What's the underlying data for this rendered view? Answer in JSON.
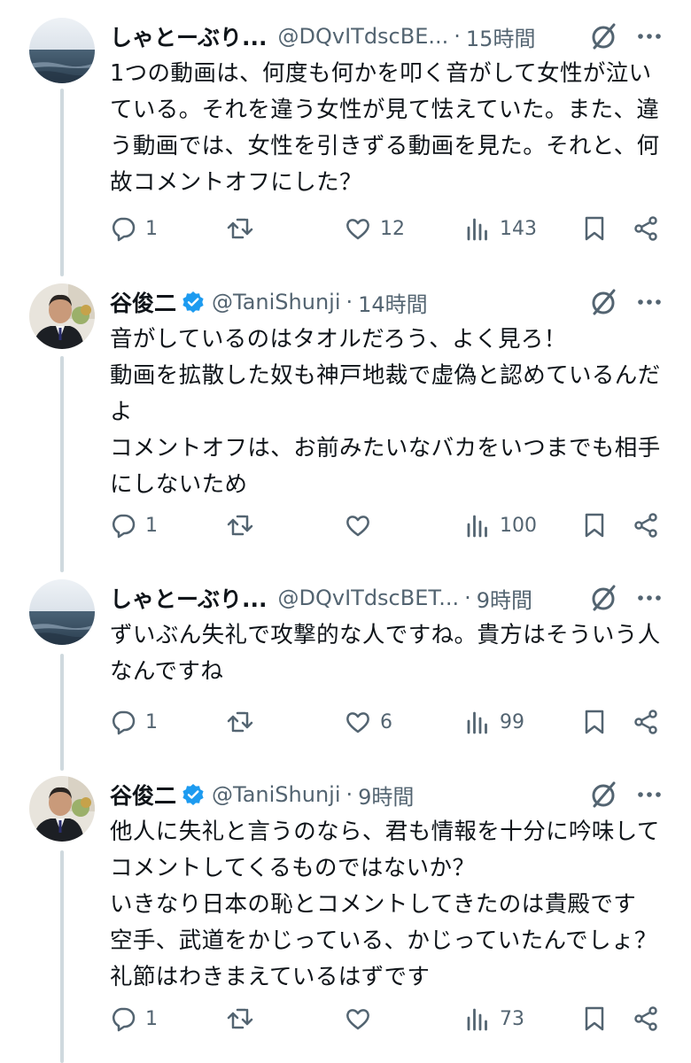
{
  "tweets": [
    {
      "name": "しゃとーぶり...",
      "handle": "@DQvITdscBE...",
      "separator": "·",
      "time": "15時間",
      "verified": false,
      "text": "1つの動画は、何度も何かを叩く音がして女性が泣いている。それを違う女性が見て怯えていた。また、違う動画では、女性を引きずる動画を見た。それと、何故コメントオフにした？",
      "replies": "1",
      "retweets": "",
      "likes": "12",
      "views": "143"
    },
    {
      "name": "谷俊二",
      "handle": "@TaniShunji",
      "separator": "·",
      "time": "14時間",
      "verified": true,
      "text": "音がしているのはタオルだろう、よく見ろ！\n動画を拡散した奴も神戸地裁で虚偽と認めているんだよ\nコメントオフは、お前みたいなバカをいつまでも相手にしないため",
      "replies": "1",
      "retweets": "",
      "likes": "",
      "views": "100"
    },
    {
      "name": "しゃとーぶり...",
      "handle": "@DQvITdscBET...",
      "separator": "·",
      "time": "9時間",
      "verified": false,
      "text": "ずいぶん失礼で攻撃的な人ですね。貴方はそういう人なんですね",
      "replies": "1",
      "retweets": "",
      "likes": "6",
      "views": "99"
    },
    {
      "name": "谷俊二",
      "handle": "@TaniShunji",
      "separator": "·",
      "time": "9時間",
      "verified": true,
      "text": "他人に失礼と言うのなら、君も情報を十分に吟味してコメントしてくるものではないか？\nいきなり日本の恥とコメントしてきたのは貴殿です\n空手、武道をかじっている、かじっていたんでしょ？礼節はわきまえているはずです",
      "replies": "1",
      "retweets": "",
      "likes": "",
      "views": "73"
    }
  ],
  "icons": {
    "reply": "reply-icon",
    "retweet": "retweet-icon",
    "like": "heart-icon",
    "views": "views-icon",
    "bookmark": "bookmark-icon",
    "share": "share-icon",
    "grok": "grok-icon",
    "more": "more-icon",
    "verified": "verified-badge-icon"
  },
  "colors": {
    "text": "#0f1419",
    "secondary": "#536471",
    "verified_blue": "#1d9bf0",
    "thread_line": "#cfd9de"
  }
}
